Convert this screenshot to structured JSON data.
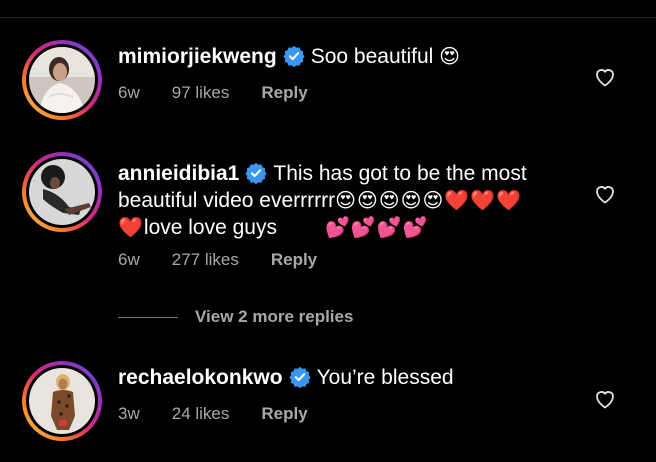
{
  "comments": [
    {
      "username": "mimiorjiekweng",
      "text": "Soo beautiful",
      "emojis": "😍",
      "time": "6w",
      "likes": "97 likes",
      "reply": "Reply",
      "verified_icon": "verified-badge-icon",
      "like_icon": "heart-outline-icon"
    },
    {
      "username": "annieidibia1",
      "text_line1": "This has got to be the most",
      "text_line2": "beautiful video everrrrrr",
      "emojis_line2": "😍😍😍😍😍❤️❤️❤️",
      "emojis_line3_prefix": "❤️",
      "text_line3": "love love guys",
      "emojis_line3_suffix": "💕💕💕💕",
      "time": "6w",
      "likes": "277 likes",
      "reply": "Reply",
      "verified_icon": "verified-badge-icon",
      "like_icon": "heart-outline-icon"
    },
    {
      "username": "rechaelokonkwo",
      "text": "You’re blessed",
      "time": "3w",
      "likes": "24 likes",
      "reply": "Reply",
      "verified_icon": "verified-badge-icon",
      "like_icon": "heart-outline-icon"
    }
  ],
  "view_more_replies": "View 2 more replies",
  "colors": {
    "background": "#000000",
    "text": "#ffffff",
    "secondary_text": "#a8a8a8",
    "verified_blue": "#3897f0"
  }
}
